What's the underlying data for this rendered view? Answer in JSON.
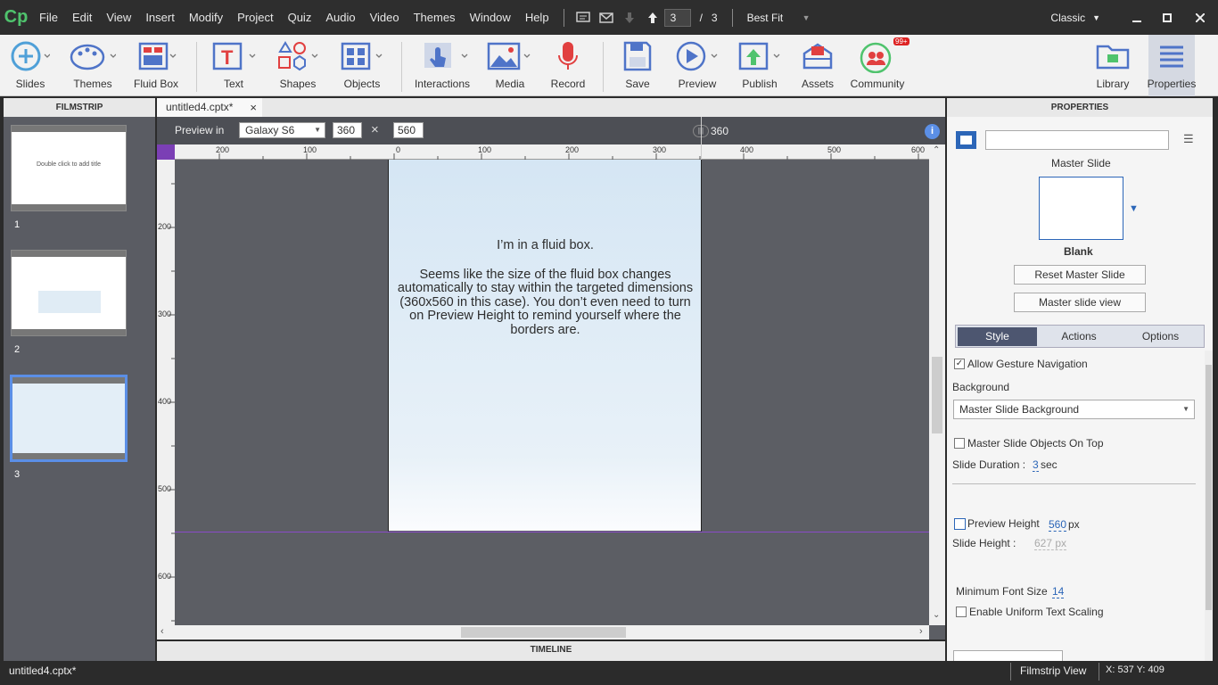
{
  "menubar": {
    "logo": "Cp",
    "items": [
      "File",
      "Edit",
      "View",
      "Insert",
      "Modify",
      "Project",
      "Quiz",
      "Audio",
      "Video",
      "Themes",
      "Window",
      "Help"
    ],
    "page_current": "3",
    "page_sep": "/",
    "page_total": "3",
    "zoom": "Best Fit",
    "workspace": "Classic"
  },
  "toolbar": {
    "slides": "Slides",
    "themes": "Themes",
    "fluid_box": "Fluid Box",
    "text": "Text",
    "shapes": "Shapes",
    "objects": "Objects",
    "interactions": "Interactions",
    "media": "Media",
    "record": "Record",
    "save": "Save",
    "preview": "Preview",
    "publish": "Publish",
    "assets": "Assets",
    "community": "Community",
    "community_badge": "99+",
    "library": "Library",
    "properties": "Properties"
  },
  "filmstrip": {
    "title": "FILMSTRIP",
    "slide1_text": "Double click to add title",
    "nums": [
      "1",
      "2",
      "3"
    ]
  },
  "document": {
    "tab": "untitled4.cptx*",
    "close": "×"
  },
  "preview": {
    "label": "Preview in",
    "device": "Galaxy S6",
    "width": "360",
    "times": "×",
    "height": "560",
    "marker": "360"
  },
  "ruler": {
    "h": [
      "200",
      "100",
      "0",
      "100",
      "200",
      "300",
      "400",
      "500",
      "600"
    ],
    "v": [
      "200",
      "300",
      "400",
      "500",
      "600"
    ]
  },
  "slide": {
    "line1": "I’m in a fluid box.",
    "paragraph": "Seems like the size of the fluid box changes automatically to stay within the targeted dimensions (360x560 in this case).  You don’t even need to turn on Preview Height to remind yourself where the borders are."
  },
  "timeline": {
    "title": "TIMELINE"
  },
  "properties": {
    "title": "PROPERTIES",
    "master_slide_label": "Master Slide",
    "master_name": "Blank",
    "reset_btn": "Reset Master Slide",
    "view_btn": "Master slide view",
    "tabs": [
      "Style",
      "Actions",
      "Options"
    ],
    "allow_gesture": "Allow Gesture Navigation",
    "background_label": "Background",
    "background_value": "Master Slide Background",
    "master_on_top": "Master Slide Objects On Top",
    "duration_label": "Slide Duration :",
    "duration_value": "3",
    "duration_unit": "sec",
    "preview_height_label": "Preview Height",
    "preview_height_value": "560",
    "px": "px",
    "slide_height_label": "Slide Height :",
    "slide_height_value": "627 px",
    "min_font_label": "Minimum Font Size",
    "min_font_value": "14",
    "uniform_scaling": "Enable Uniform Text Scaling"
  },
  "status": {
    "file": "untitled4.cptx*",
    "view": "Filmstrip View",
    "coords": "X: 537 Y: 409"
  },
  "colors": {
    "accent": "#4fc36d",
    "selected_tab": "#4d5670",
    "link": "#2c66b8"
  }
}
